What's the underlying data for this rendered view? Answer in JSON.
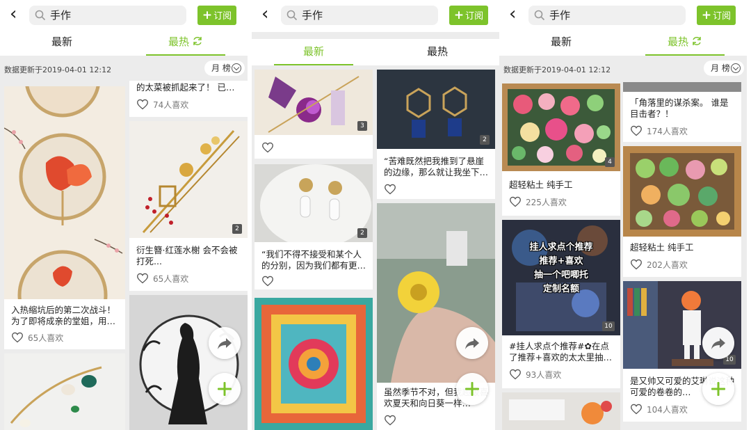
{
  "colors": {
    "accent": "#7dc32b",
    "feed_bg": "#ececec"
  },
  "icons": [
    "back-arrow-icon",
    "search-icon",
    "plus-icon",
    "refresh-icon",
    "chevron-down-icon",
    "heart-icon",
    "share-icon"
  ],
  "panels": [
    {
      "search_query": "手作",
      "subscribe_label": "订阅",
      "tabs": [
        "最新",
        "最热"
      ],
      "active_tab": 1,
      "data_updated": "数据更新于2019-04-01 12:12",
      "ranking_label": "月 榜",
      "cards": [
        {
          "text": "的太菜被抓起来了！ 已…",
          "likes": "74人喜欢"
        },
        {
          "text": "衍生簪·红莲水榭 会不会被打死...",
          "likes": "65人喜欢",
          "count": "2"
        },
        {
          "text": "入热缩坑后的第二次战斗！为了即将成亲的堂姐，用…",
          "likes": "65人喜欢"
        }
      ]
    },
    {
      "search_query": "手作",
      "subscribe_label": "订阅",
      "tabs": [
        "最新",
        "最热"
      ],
      "active_tab": 0,
      "cards": [
        {
          "text": "",
          "likes": "",
          "count": "3"
        },
        {
          "text": "“苦难既然把我推到了悬崖的边缘，那么就让我坐下…",
          "likes": "",
          "count": "2"
        },
        {
          "text": "“我们不得不接受和某个人的分别，因为我们都有更…",
          "likes": "",
          "count": "2"
        },
        {
          "text": "虽然季节不对，但我超级喜欢夏天和向日葵一样…",
          "likes": ""
        }
      ]
    },
    {
      "search_query": "手作",
      "subscribe_label": "订阅",
      "tabs": [
        "最新",
        "最热"
      ],
      "active_tab": 1,
      "data_updated": "数据更新于2019-04-01 12:12",
      "ranking_label": "月 榜",
      "cards": [
        {
          "text": "「角落里的谋杀案。 谁是目击者？！",
          "likes": "174人喜欢"
        },
        {
          "text": "超轻粘土 纯手工",
          "likes": "225人喜欢",
          "count": "4"
        },
        {
          "text": "超轻粘土 纯手工",
          "likes": "202人喜欢"
        },
        {
          "text": "#挂人求点个推荐#✿在点了推荐+喜欢的太太里抽…",
          "likes": "93人喜欢",
          "count": "10"
        },
        {
          "text": "是又帅又可爱的艾琳说这种可爱的卷卷的…",
          "likes": "104人喜欢",
          "count": "10"
        }
      ],
      "image_overlay_lines": [
        "挂人求点个推荐",
        "推荐+喜欢",
        "抽一个吧唧托",
        "定制名额"
      ]
    }
  ]
}
